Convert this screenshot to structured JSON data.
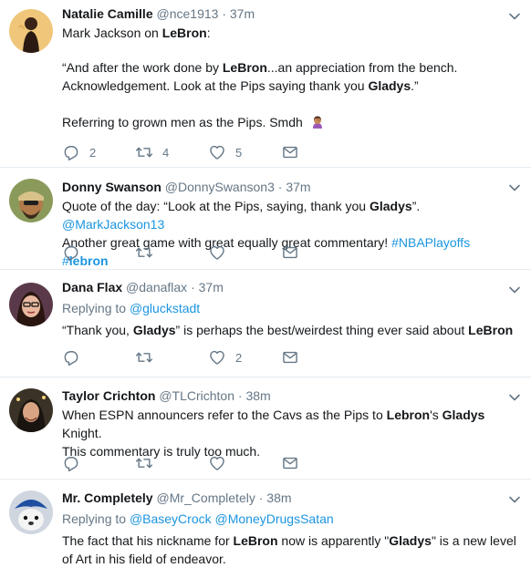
{
  "tweets": [
    {
      "name": "Natalie Camille",
      "handle": "@nce1913",
      "time": "37m",
      "line1_a": "Mark Jackson on ",
      "line1_b": "LeBron",
      "line1_c": ":",
      "line2_a": "“And after the work done by ",
      "line2_b": "LeBron",
      "line2_c": "...an appreciation from the bench.",
      "line3_a": "Acknowledgement. Look at the Pips saying thank you ",
      "line3_b": "Gladys",
      "line3_c": ".”",
      "line4": "Referring to grown men as the Pips. Smdh",
      "emoji": "woman-facepalming-emoji",
      "reply_count": "2",
      "retweet_count": "4",
      "like_count": "5"
    },
    {
      "name": "Donny Swanson",
      "handle": "@DonnySwanson3",
      "time": "37m",
      "line1_a": "Quote of the day: “Look at the Pips, saying, thank you ",
      "line1_b": "Gladys",
      "line1_c": "”. ",
      "mention": "@MarkJackson13",
      "line2_a": "Another great game with great equally great commentary! ",
      "hashtag1": "#NBAPlayoffs",
      "hashtag2_a": "#",
      "hashtag2_b": "lebron",
      "reply_count": "",
      "retweet_count": "",
      "like_count": ""
    },
    {
      "name": "Dana Flax",
      "handle": "@danaflax",
      "time": "37m",
      "replying_to": "Replying to ",
      "replying_handle": "@gluckstadt",
      "line1_a": "“Thank you, ",
      "line1_b": "Gladys",
      "line1_c": "” is perhaps the best/weirdest thing ever said about ",
      "line1_d": "LeBron",
      "reply_count": "",
      "retweet_count": "",
      "like_count": "2"
    },
    {
      "name": "Taylor Crichton",
      "handle": "@TLCrichton",
      "time": "38m",
      "line1_a": "When ESPN announcers refer to the Cavs as the Pips to ",
      "line1_b": "Lebron",
      "line1_c": "'s ",
      "line1_d": "Gladys",
      "line1_e": " Knight.",
      "line2": "This commentary is truly too much.",
      "reply_count": "",
      "retweet_count": "",
      "like_count": ""
    },
    {
      "name": "Mr. Completely",
      "handle": "@Mr_Completely",
      "time": "38m",
      "replying_to": "Replying to ",
      "replying_handle1": "@BaseyCrock",
      "replying_handle2": "@MoneyDrugsSatan",
      "line1_a": "The fact that his nickname for ",
      "line1_b": "LeBron",
      "line1_c": " now is apparently \"",
      "line1_d": "Gladys",
      "line1_e": "\" is a new level",
      "line2": "of Art in his field of endeavor."
    }
  ],
  "separator": "·",
  "colors": {
    "link": "#1b95e0",
    "secondary": "#657786",
    "divider": "#e6ecf0"
  }
}
